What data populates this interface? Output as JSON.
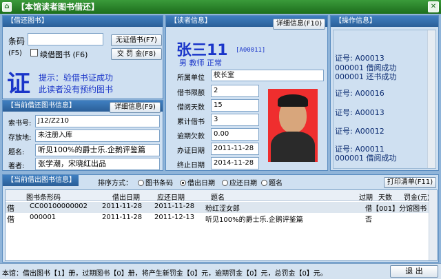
{
  "window": {
    "title": "【本馆读者图书借还】",
    "close_glyph": "✕",
    "app_icon_glyph": "⌂"
  },
  "borrow": {
    "header": "【借还图书】",
    "barcode_label": "条码",
    "barcode_value": "",
    "no_card_btn": "无证借书(F7)",
    "fine_btn": "交 罚 金(F8)",
    "f5_label": "(F5)",
    "renew_label": "续借图书 (F6)",
    "big_char": "证",
    "tip_line1": "提示：验借书证成功",
    "tip_line2": "此读者没有预约图书"
  },
  "book": {
    "header": "【当前借还图书信息】",
    "detail_btn": "详细信息(F9)",
    "fields": [
      {
        "label": "索书号:",
        "value": "J12/Z210"
      },
      {
        "label": "存放地:",
        "value": "未注册入库"
      },
      {
        "label": "题名:",
        "value": "听见100%的爵士乐.企鹅评鉴篇"
      },
      {
        "label": "著者:",
        "value": "张学潮，宋晓红出品"
      }
    ]
  },
  "reader": {
    "header": "【读者信息】",
    "detail_btn": "详细信息(F10)",
    "name": "张三11",
    "id": "[A00011]",
    "sub": "男 教师 正常",
    "unit_label": "所属单位",
    "unit_value": "校长室",
    "fields": [
      {
        "label": "借书限额",
        "value": "2"
      },
      {
        "label": "借阅天数",
        "value": "15"
      },
      {
        "label": "累计借书",
        "value": "3"
      },
      {
        "label": "逾期欠款",
        "value": "0.00"
      },
      {
        "label": "办证日期",
        "value": "2011-11-28"
      },
      {
        "label": "终止日期",
        "value": "2014-11-28"
      }
    ]
  },
  "ops": {
    "header": "【操作信息】",
    "lines": [
      {
        "text": "证号: A00013",
        "selected": false
      },
      {
        "text": "  000001 借阅成功",
        "selected": false
      },
      {
        "text": "  000001 还书成功",
        "selected": false
      },
      {
        "text": "证号: A00016",
        "selected": false
      },
      {
        "text": "证号: A00013",
        "selected": false
      },
      {
        "text": "证号: A00012",
        "selected": false
      },
      {
        "text": "证号: A00011",
        "selected": false
      },
      {
        "text": "  000001 借阅成功",
        "selected": false
      },
      {
        "text": "证号: A00011",
        "selected": true
      }
    ]
  },
  "list": {
    "header": "【当前借出图书信息】",
    "sort_label": "排序方式：",
    "sort_options": [
      {
        "label": "图书条码",
        "on": false
      },
      {
        "label": "借出日期",
        "on": true
      },
      {
        "label": "应还日期",
        "on": false
      },
      {
        "label": "题名",
        "on": false
      }
    ],
    "print_btn": "打印清单(F11)",
    "columns": [
      "图书条形码",
      "借出日期",
      "应还日期",
      "题名",
      "过期",
      "天数",
      "罚金(元)"
    ],
    "rows": [
      {
        "type": "借",
        "barcode": "CC00100000002",
        "out": "2011-11-28",
        "due": "2011-11-28",
        "title": "粉红涩女郎",
        "overdue": "借【001】分馆图书",
        "days": "",
        "fine": "",
        "selected": true
      },
      {
        "type": "借",
        "barcode": "000001",
        "out": "2011-11-28",
        "due": "2011-12-13",
        "title": "听见100%的爵士乐.企鹅评鉴篇",
        "overdue": "否",
        "days": "",
        "fine": "",
        "selected": false
      }
    ]
  },
  "status": {
    "text": "本馆：借出图书【1】册，过期图书【0】册，将产生新罚金【0】元，逾期罚金【0】元，总罚金【0】元。",
    "exit_btn": "退 出"
  },
  "colors": {
    "title_green": "#1d6e1d",
    "panel_blue": "#2b5f98",
    "accent_text": "#1a35c9"
  }
}
